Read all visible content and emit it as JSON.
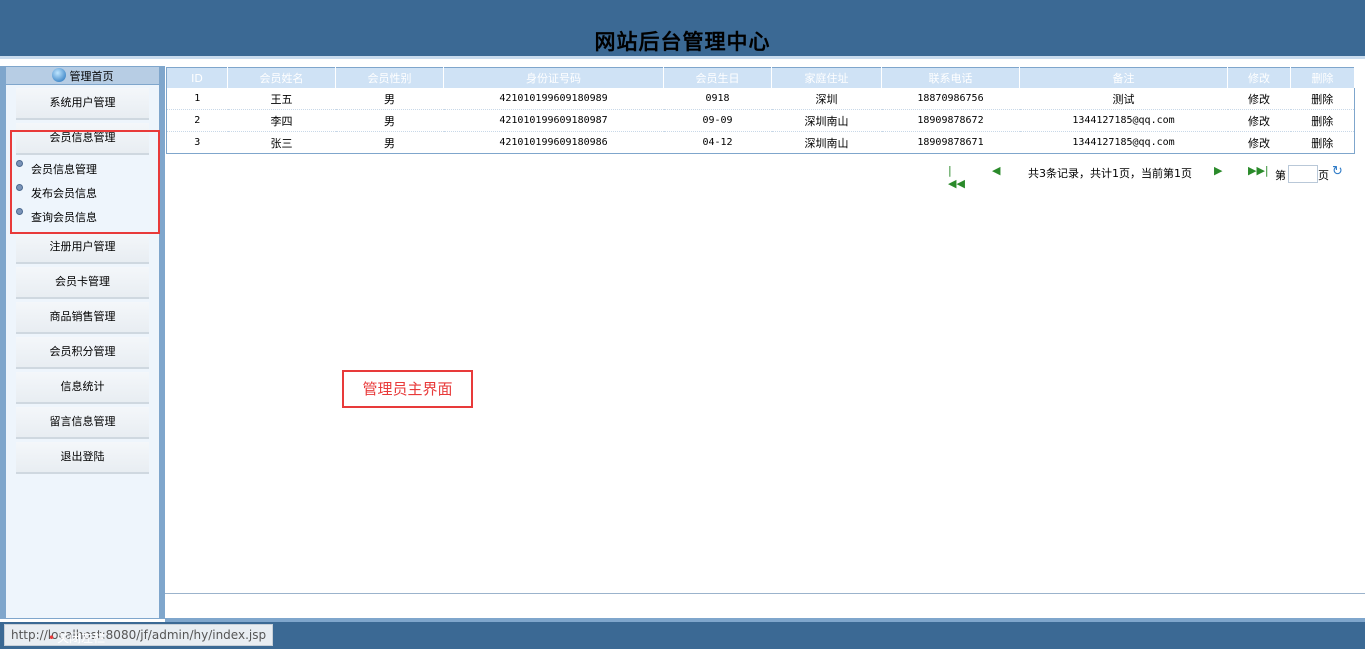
{
  "header": {
    "title": "网站后台管理中心"
  },
  "sidebar": {
    "home_label": "管理首页",
    "items": [
      {
        "label": "系统用户管理"
      },
      {
        "label": "会员信息管理"
      },
      {
        "label": "注册用户管理"
      },
      {
        "label": "会员卡管理"
      },
      {
        "label": "商品销售管理"
      },
      {
        "label": "会员积分管理"
      },
      {
        "label": "信息统计"
      },
      {
        "label": "留言信息管理"
      },
      {
        "label": "退出登陆"
      }
    ],
    "sub_items": [
      {
        "label": "会员信息管理"
      },
      {
        "label": "发布会员信息"
      },
      {
        "label": "查询会员信息"
      }
    ]
  },
  "table": {
    "columns": [
      "ID",
      "会员姓名",
      "会员性别",
      "身份证号码",
      "会员生日",
      "家庭住址",
      "联系电话",
      "备注",
      "修改",
      "删除"
    ],
    "rows": [
      [
        "1",
        "王五",
        "男",
        "421010199609180989",
        "0918",
        "深圳",
        "18870986756",
        "测试",
        "修改",
        "删除"
      ],
      [
        "2",
        "李四",
        "男",
        "421010199609180987",
        "09-09",
        "深圳南山",
        "18909878672",
        "1344127185@qq.com",
        "修改",
        "删除"
      ],
      [
        "3",
        "张三",
        "男",
        "421010199609180986",
        "04-12",
        "深圳南山",
        "18909878671",
        "1344127185@qq.com",
        "修改",
        "删除"
      ]
    ]
  },
  "pager": {
    "summary": "共3条记录，共计1页，当前第1页",
    "first_icon": "first-page-icon",
    "prev_icon": "prev-page-icon",
    "next_icon": "next-page-icon",
    "last_icon": "last-page-icon",
    "before_input": "第",
    "after_input": "页",
    "page_input_value": ""
  },
  "annotation": {
    "text": "管理员主界面"
  },
  "footer": {
    "status_url": "http://localhost:8080/jf/admin/hy/index.jsp",
    "close_left": "关闭左栏"
  },
  "colors": {
    "header_bg": "#3b6994",
    "sidebar_bg": "#7fa6cc",
    "highlight_red": "#e83a3a"
  }
}
